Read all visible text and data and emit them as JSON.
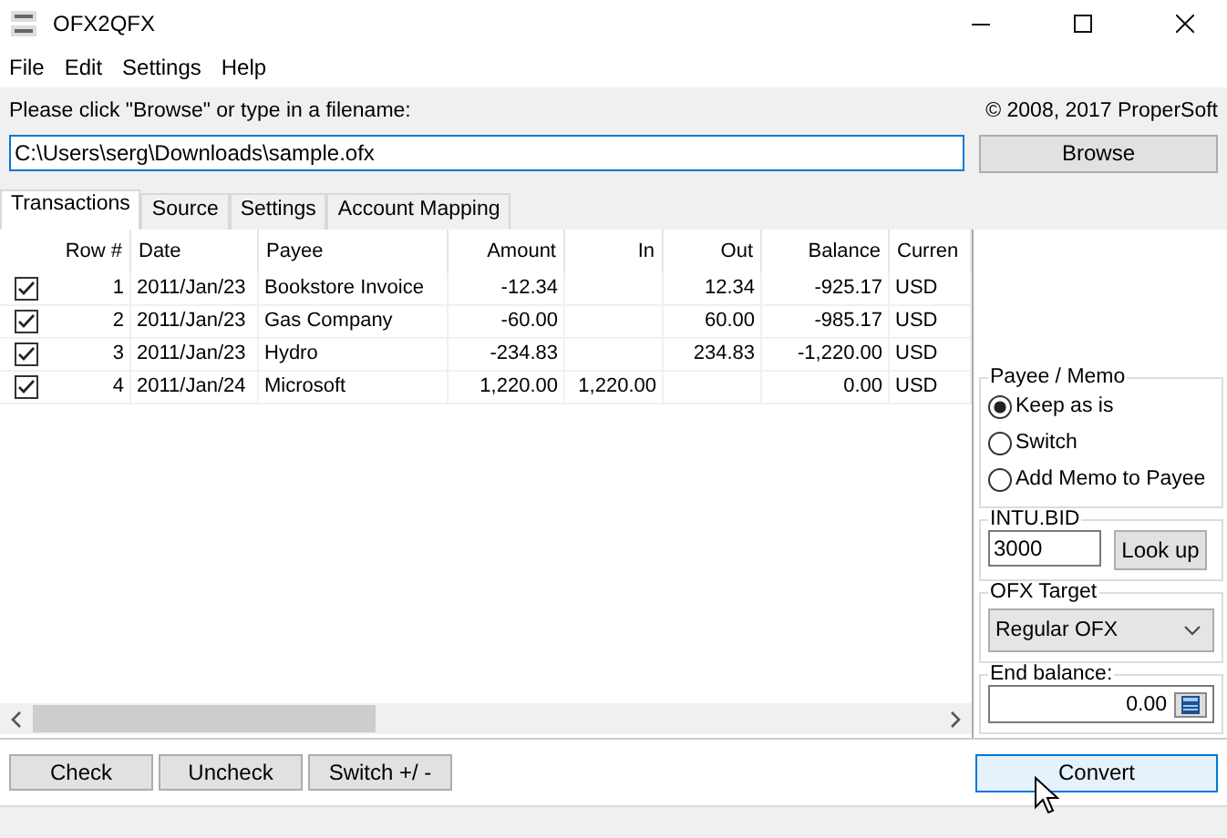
{
  "window": {
    "title": "OFX2QFX"
  },
  "menu": [
    "File",
    "Edit",
    "Settings",
    "Help"
  ],
  "file_prompt": "Please click \"Browse\" or type in a filename:",
  "copyright": "© 2008, 2017 ProperSoft",
  "file_field": {
    "value": "C:\\Users\\serg\\Downloads\\sample.ofx"
  },
  "browse_button": "Browse",
  "tabs": [
    {
      "label": "Transactions",
      "selected": true
    },
    {
      "label": "Source",
      "selected": false
    },
    {
      "label": "Settings",
      "selected": false
    },
    {
      "label": "Account Mapping",
      "selected": false
    }
  ],
  "table": {
    "columns": [
      "Row #",
      "Date",
      "Payee",
      "Amount",
      "In",
      "Out",
      "Balance",
      "Curren"
    ],
    "rows": [
      {
        "checked": true,
        "cells": [
          "1",
          "2011/Jan/23",
          "Bookstore Invoice",
          "-12.34",
          "",
          "12.34",
          "-925.17",
          "USD"
        ]
      },
      {
        "checked": true,
        "cells": [
          "2",
          "2011/Jan/23",
          "Gas Company",
          "-60.00",
          "",
          "60.00",
          "-985.17",
          "USD"
        ]
      },
      {
        "checked": true,
        "cells": [
          "3",
          "2011/Jan/23",
          "Hydro",
          "-234.83",
          "",
          "234.83",
          "-1,220.00",
          "USD"
        ]
      },
      {
        "checked": true,
        "cells": [
          "4",
          "2011/Jan/24",
          "Microsoft",
          "1,220.00",
          "1,220.00",
          "",
          "0.00",
          "USD"
        ]
      }
    ]
  },
  "payee_memo": {
    "title": "Payee / Memo",
    "options": [
      {
        "label": "Keep as is",
        "selected": true
      },
      {
        "label": "Switch",
        "selected": false
      },
      {
        "label": "Add Memo to Payee",
        "selected": false
      }
    ]
  },
  "intu_bid": {
    "title": "INTU.BID",
    "value": "3000",
    "button": "Look up"
  },
  "ofx_target": {
    "title": "OFX Target",
    "value": "Regular OFX"
  },
  "end_balance": {
    "title": "End balance:",
    "value": "0.00"
  },
  "buttons": [
    "Check",
    "Uncheck",
    "Switch +/ -"
  ],
  "convert_button": "Convert"
}
